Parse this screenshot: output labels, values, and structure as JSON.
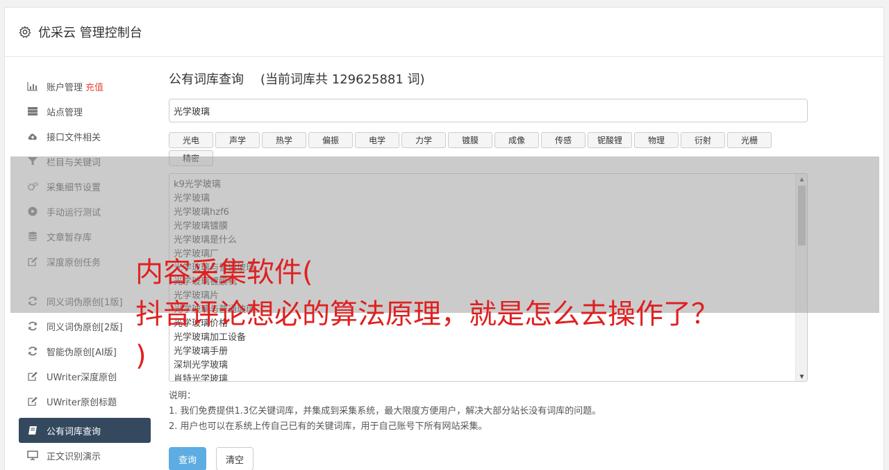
{
  "header": {
    "title": "优采云 管理控制台",
    "icon": "gear-icon"
  },
  "sidebar": {
    "items": [
      {
        "label": "账户管理",
        "badge": "充值",
        "icon": "bar-chart-icon"
      },
      {
        "label": "站点管理",
        "icon": "server-icon"
      },
      {
        "label": "接口文件相关",
        "icon": "cloud-upload-icon"
      },
      {
        "label": "栏目与关键词",
        "icon": "filter-icon"
      },
      {
        "label": "采集细节设置",
        "icon": "cogs-icon"
      },
      {
        "label": "手动运行测试",
        "icon": "play-icon"
      },
      {
        "label": "文章暂存库",
        "icon": "database-icon"
      },
      {
        "label": "深度原创任务",
        "icon": "edit-icon"
      },
      {
        "label": "同义词伪原创[1版]",
        "icon": "refresh-icon"
      },
      {
        "label": "同义词伪原创[2版]",
        "icon": "refresh-icon"
      },
      {
        "label": "智能伪原创[AI版]",
        "icon": "refresh-icon"
      },
      {
        "label": "UWriter深度原创",
        "icon": "edit-icon"
      },
      {
        "label": "UWriter原创标题",
        "icon": "edit-icon"
      },
      {
        "label": "公有词库查询",
        "icon": "book-icon",
        "active": true
      },
      {
        "label": "正文识别演示",
        "icon": "monitor-icon"
      }
    ]
  },
  "main": {
    "title": "公有词库查询",
    "count_text": "(当前词库共 129625881 词)",
    "search_value": "光学玻璃",
    "tags": [
      "光电",
      "声学",
      "热学",
      "偏振",
      "电学",
      "力学",
      "镀膜",
      "成像",
      "传感",
      "铌酸锂",
      "物理",
      "衍射",
      "光栅",
      "精密"
    ],
    "results": [
      "k9光学玻璃",
      "光学玻璃",
      "光学玻璃hzf6",
      "光学玻璃镀膜",
      "光学玻璃是什么",
      "光学玻璃厂",
      "光学玻璃与普通玻璃",
      "光学玻璃镀膜机",
      "光学玻璃片",
      "光学玻璃与普通玻璃",
      "光学玻璃价格",
      "光学玻璃加工设备",
      "光学玻璃手册",
      "深圳光学玻璃",
      "肖特光学玻璃"
    ],
    "notes": {
      "heading": "说明：",
      "line1": "1. 我们免费提供1.3亿关键词库，并集成到采集系统，最大限度方便用户，解决大部分站长没有词库的问题。",
      "line2": "2. 用户也可以在系统上传自己已有的关键词库，用于自己账号下所有网站采集。"
    },
    "query_button": "查询",
    "clear_button": "清空"
  },
  "overlay": {
    "headline": "内容采集软件(\n抖音评论想必的算法原理，就是怎么去操作了？\n)",
    "color": "#e02020"
  }
}
